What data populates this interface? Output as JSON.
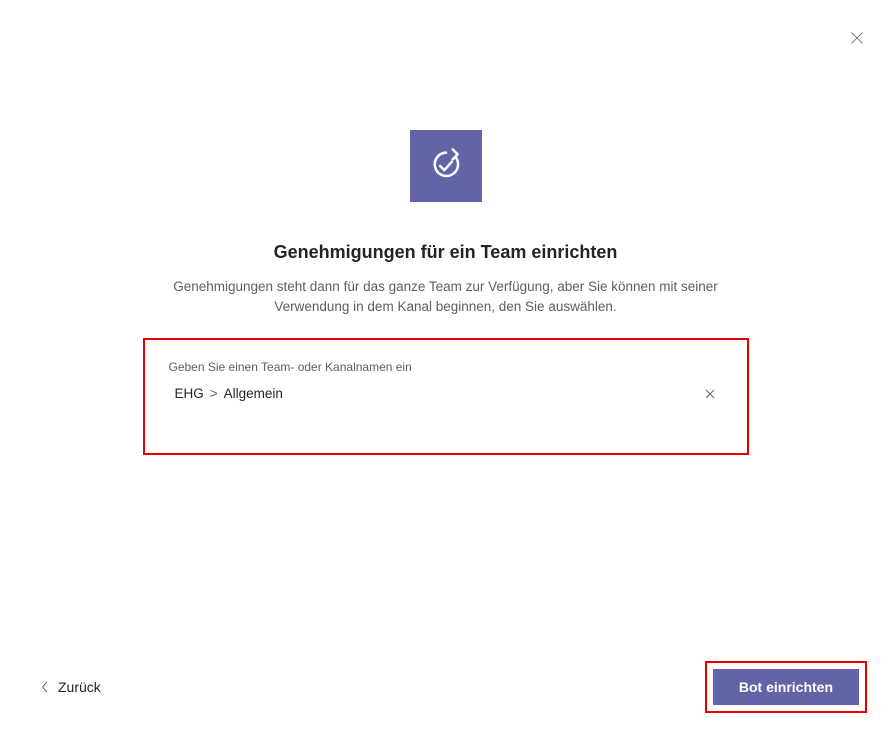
{
  "dialog": {
    "title": "Genehmigungen für ein Team einrichten",
    "subtitle": "Genehmigungen steht dann für das ganze Team zur Verfügung, aber Sie können mit seiner Verwendung in dem Kanal beginnen, den Sie auswählen."
  },
  "channelField": {
    "label": "Geben Sie einen Team- oder Kanalnamen ein",
    "selectedTeam": "EHG",
    "separator": ">",
    "selectedChannel": "Allgemein"
  },
  "footer": {
    "backLabel": "Zurück",
    "primaryLabel": "Bot einrichten"
  }
}
